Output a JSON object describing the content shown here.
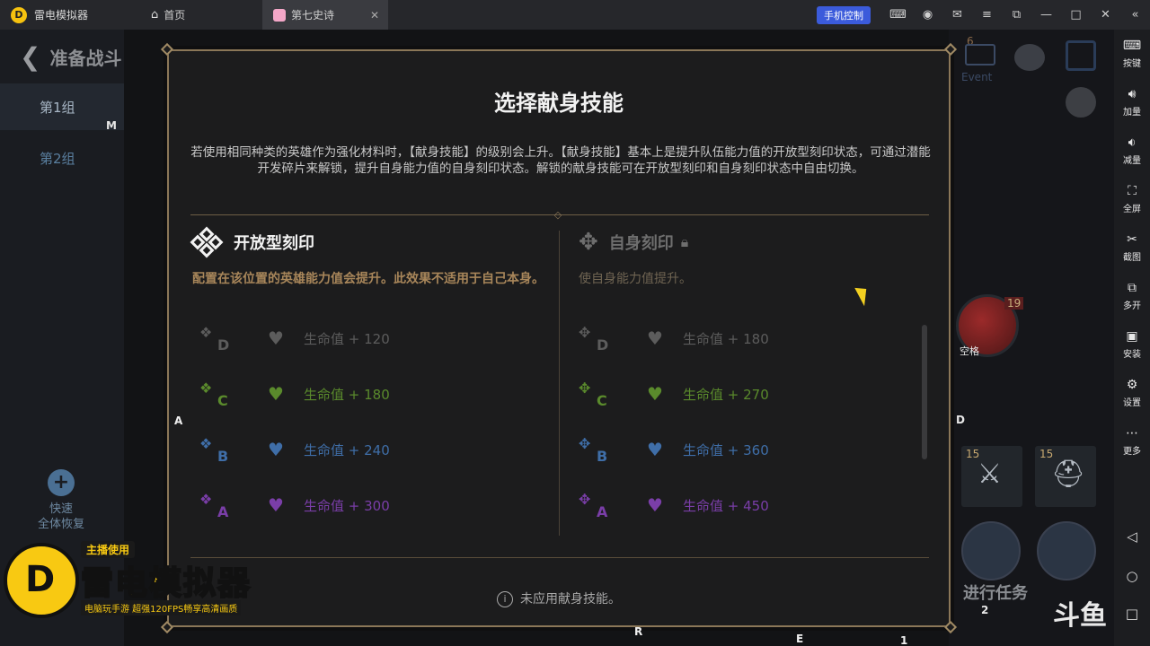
{
  "titlebar": {
    "app_name": "雷电模拟器",
    "tabs": [
      {
        "label": "首页"
      },
      {
        "label": "第七史诗"
      }
    ],
    "phone_control": "手机控制"
  },
  "sidebar": {
    "items": [
      {
        "label": "按键",
        "icon": "keyboard-icon"
      },
      {
        "label": "加量",
        "icon": "volume-up-icon"
      },
      {
        "label": "减量",
        "icon": "volume-down-icon"
      },
      {
        "label": "全屏",
        "icon": "fullscreen-icon"
      },
      {
        "label": "截图",
        "icon": "scissors-icon"
      },
      {
        "label": "多开",
        "icon": "multi-instance-icon"
      },
      {
        "label": "安装",
        "icon": "apk-icon"
      },
      {
        "label": "设置",
        "icon": "settings-icon"
      },
      {
        "label": "更多",
        "icon": "more-icon"
      }
    ]
  },
  "game": {
    "back_title": "准备战斗",
    "groups": [
      "第1组",
      "第2组"
    ],
    "quick_restore": "快速\n全体恢复",
    "mail_label": "Event",
    "mail_count": "6",
    "hero_level": "19",
    "space_label": "空格",
    "equip_levels": [
      "15",
      "15"
    ],
    "task_label": "进行任务",
    "douyu": "斗鱼"
  },
  "watermark": {
    "tag": "主播使用",
    "title": "雷电模拟器",
    "subtitle": "电脑玩手游 超强120FPS畅享高清画质"
  },
  "modal": {
    "title": "选择献身技能",
    "description": "若使用相同种类的英雄作为强化材料时，【献身技能】的级别会上升。【献身技能】基本上是提升队伍能力值的开放型刻印状态，可通过潜能开发碎片来解锁，提升自身能力值的自身刻印状态。解锁的献身技能可在开放型刻印和自身刻印状态中自由切换。",
    "open": {
      "title": "开放型刻印",
      "desc": "配置在该位置的英雄能力值会提升。此效果不适用于自己本身。",
      "rows": [
        {
          "tier": "D",
          "stat": "生命值 + 120"
        },
        {
          "tier": "C",
          "stat": "生命值 + 180"
        },
        {
          "tier": "B",
          "stat": "生命值 + 240"
        },
        {
          "tier": "A",
          "stat": "生命值 + 300"
        }
      ]
    },
    "self": {
      "title": "自身刻印",
      "desc": "使自身能力值提升。",
      "rows": [
        {
          "tier": "D",
          "stat": "生命值 + 180"
        },
        {
          "tier": "C",
          "stat": "生命值 + 270"
        },
        {
          "tier": "B",
          "stat": "生命值 + 360"
        },
        {
          "tier": "A",
          "stat": "生命值 + 450"
        }
      ]
    },
    "footer_note": "未应用献身技能。"
  },
  "key_labels": {
    "m": "M",
    "a": "A",
    "d": "D",
    "r": "R",
    "e": "E",
    "one": "1",
    "two": "2"
  },
  "colors": {
    "tier_d": "#5c5c5c",
    "tier_c": "#5a8a2c",
    "tier_b": "#3f6ea8",
    "tier_a": "#7a3ea8",
    "modal_border": "#8b7758",
    "accent_gold": "#a8865a"
  }
}
